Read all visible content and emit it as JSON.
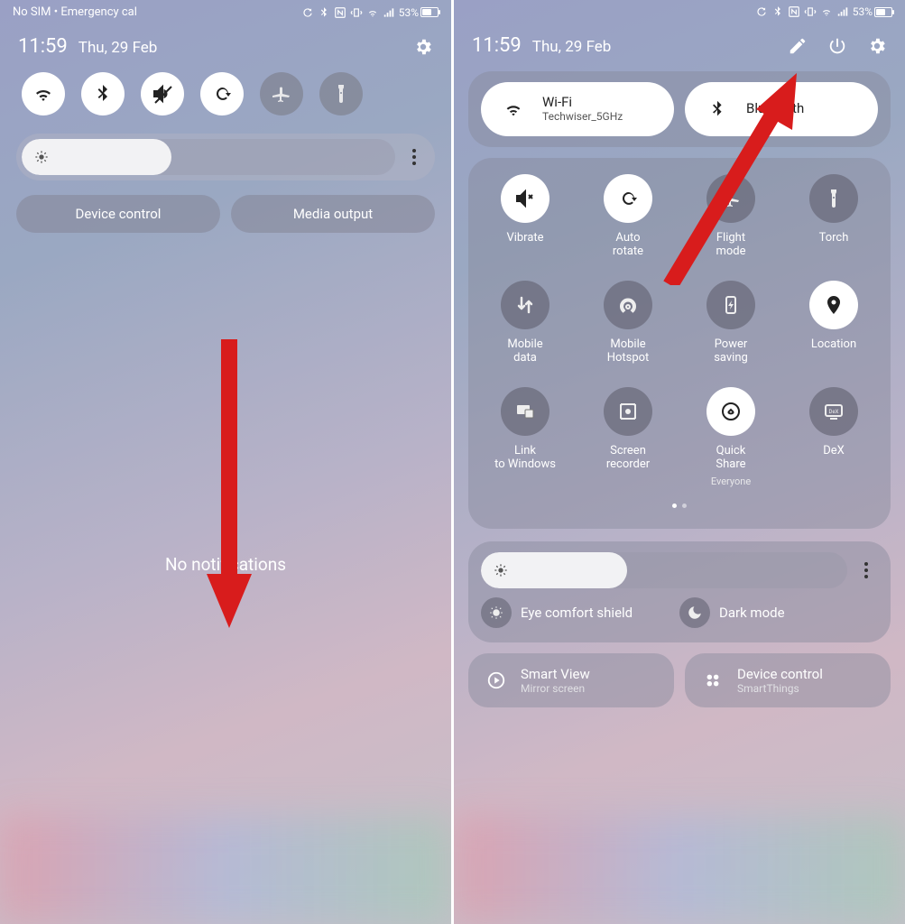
{
  "status": {
    "left_text": "No SIM • Emergency cal",
    "battery_pct": "53%"
  },
  "header": {
    "time": "11:59",
    "date": "Thu, 29 Feb"
  },
  "panel1": {
    "buttons": {
      "device_control": "Device control",
      "media_output": "Media output"
    },
    "no_notifications": "No notifications"
  },
  "panel2": {
    "wifi": {
      "title": "Wi-Fi",
      "subtitle": "Techwiser_5GHz"
    },
    "bluetooth": {
      "title": "Bluetooth"
    },
    "grid": [
      {
        "key": "vibrate",
        "label": "Vibrate",
        "sub": "",
        "on": true
      },
      {
        "key": "autorotate",
        "label": "Auto rotate",
        "sub": "",
        "on": true
      },
      {
        "key": "flight",
        "label": "Flight mode",
        "sub": "",
        "on": false
      },
      {
        "key": "torch",
        "label": "Torch",
        "sub": "",
        "on": false
      },
      {
        "key": "mobiledata",
        "label": "Mobile data",
        "sub": "",
        "on": false
      },
      {
        "key": "hotspot",
        "label": "Mobile Hotspot",
        "sub": "",
        "on": false
      },
      {
        "key": "powersave",
        "label": "Power saving",
        "sub": "",
        "on": false
      },
      {
        "key": "location",
        "label": "Location",
        "sub": "",
        "on": true
      },
      {
        "key": "linkwin",
        "label": "Link to Windows",
        "sub": "",
        "on": false
      },
      {
        "key": "screenrec",
        "label": "Screen recorder",
        "sub": "",
        "on": false
      },
      {
        "key": "quickshare",
        "label": "Quick Share",
        "sub": "Everyone",
        "on": true
      },
      {
        "key": "dex",
        "label": "DeX",
        "sub": "",
        "on": false
      }
    ],
    "eye_comfort": "Eye comfort shield",
    "dark_mode": "Dark mode",
    "smart_view": {
      "title": "Smart View",
      "subtitle": "Mirror screen"
    },
    "device_control": {
      "title": "Device control",
      "subtitle": "SmartThings"
    }
  },
  "brightness_pct": 40
}
